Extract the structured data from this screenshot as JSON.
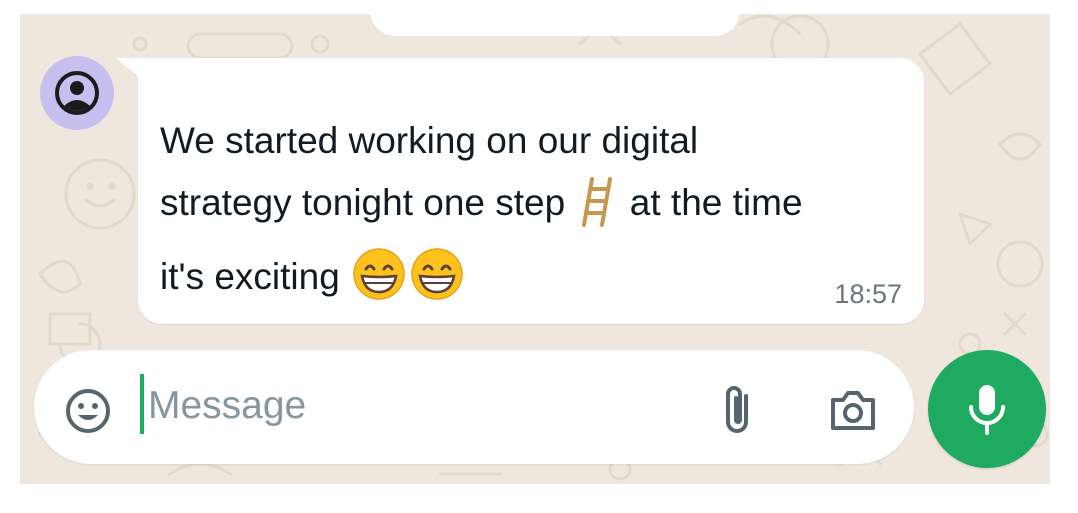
{
  "chat": {
    "message": {
      "text_line1": "We started working on our digital",
      "text_line2a": "strategy tonight one step ",
      "text_line2b": " at the time",
      "text_line3": "it's exciting ",
      "emoji_ladder": "ladder-icon",
      "emoji_grin": "grinning-face-icon",
      "time": "18:57"
    },
    "avatar": "person-icon"
  },
  "composer": {
    "placeholder": "Message",
    "value": "",
    "icons": [
      "emoji-icon",
      "paperclip-icon",
      "camera-icon",
      "microphone-icon"
    ]
  },
  "colors": {
    "accent": "#1faa61",
    "chat_background": "#efe7dd",
    "avatar_background": "#c7bff0",
    "bubble": "#ffffff"
  }
}
